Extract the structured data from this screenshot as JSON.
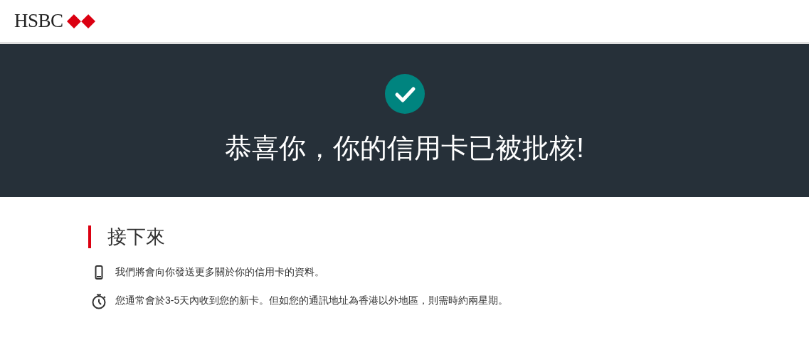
{
  "header": {
    "logo_text": "HSBC"
  },
  "banner": {
    "title": "恭喜你，你的信用卡已被批核!"
  },
  "next_steps": {
    "heading": "接下來",
    "items": [
      {
        "kind": "phone",
        "text": "我們將會向你發送更多關於你的信用卡的資料。"
      },
      {
        "kind": "timer",
        "text": "您通常會於3-5天內收到您的新卡。但如您的通訊地址為香港以外地區，則需時約兩星期。"
      }
    ]
  }
}
